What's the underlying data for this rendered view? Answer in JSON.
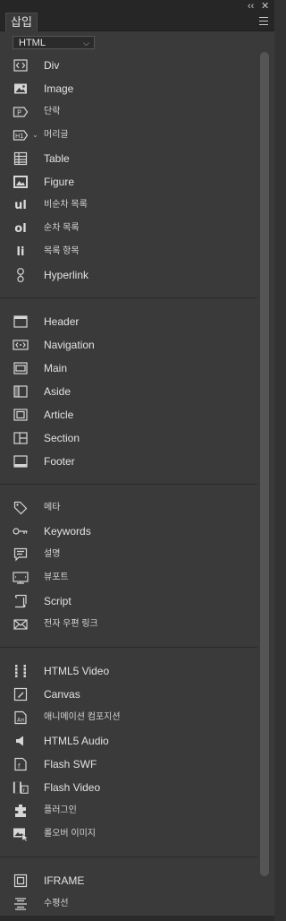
{
  "window": {
    "collapse_glyph": "‹‹",
    "close_glyph": "✕"
  },
  "panel": {
    "tab_title": "삽입",
    "category_select": "HTML"
  },
  "groups": [
    [
      {
        "id": "div",
        "label": "Div",
        "icon": "div-icon"
      },
      {
        "id": "image",
        "label": "Image",
        "icon": "image-icon"
      },
      {
        "id": "paragraph",
        "label": "단락",
        "icon": "paragraph-icon"
      },
      {
        "id": "heading",
        "label": "머리글",
        "icon": "heading-icon",
        "dropdown": true
      },
      {
        "id": "table",
        "label": "Table",
        "icon": "table-icon"
      },
      {
        "id": "figure",
        "label": "Figure",
        "icon": "figure-icon"
      },
      {
        "id": "ul",
        "label": "비순차 목록",
        "icon": "unordered-list-icon",
        "text_icon": "ul"
      },
      {
        "id": "ol",
        "label": "순차 목록",
        "icon": "ordered-list-icon",
        "text_icon": "ol"
      },
      {
        "id": "li",
        "label": "목록 항목",
        "icon": "list-item-icon",
        "text_icon": "li"
      },
      {
        "id": "hyperlink",
        "label": "Hyperlink",
        "icon": "hyperlink-icon"
      }
    ],
    [
      {
        "id": "header",
        "label": "Header",
        "icon": "header-icon"
      },
      {
        "id": "navigation",
        "label": "Navigation",
        "icon": "navigation-icon"
      },
      {
        "id": "main",
        "label": "Main",
        "icon": "main-icon"
      },
      {
        "id": "aside",
        "label": "Aside",
        "icon": "aside-icon"
      },
      {
        "id": "article",
        "label": "Article",
        "icon": "article-icon"
      },
      {
        "id": "section",
        "label": "Section",
        "icon": "section-icon"
      },
      {
        "id": "footer",
        "label": "Footer",
        "icon": "footer-icon"
      }
    ],
    [
      {
        "id": "meta",
        "label": "메타",
        "icon": "tag-icon"
      },
      {
        "id": "keywords",
        "label": "Keywords",
        "icon": "key-icon"
      },
      {
        "id": "description",
        "label": "설명",
        "icon": "description-icon"
      },
      {
        "id": "viewport",
        "label": "뷰포트",
        "icon": "viewport-icon"
      },
      {
        "id": "script",
        "label": "Script",
        "icon": "script-icon"
      },
      {
        "id": "email",
        "label": "전자 우편 링크",
        "icon": "email-icon"
      }
    ],
    [
      {
        "id": "video",
        "label": "HTML5 Video",
        "icon": "video-icon"
      },
      {
        "id": "canvas",
        "label": "Canvas",
        "icon": "canvas-icon"
      },
      {
        "id": "animation",
        "label": "애니메이션 컴포지션",
        "icon": "animation-icon"
      },
      {
        "id": "audio",
        "label": "HTML5 Audio",
        "icon": "audio-icon"
      },
      {
        "id": "flashswf",
        "label": "Flash SWF",
        "icon": "flash-swf-icon"
      },
      {
        "id": "flashvideo",
        "label": "Flash Video",
        "icon": "flash-video-icon"
      },
      {
        "id": "plugin",
        "label": "플러그인",
        "icon": "plugin-icon"
      },
      {
        "id": "rollover",
        "label": "롤오버 이미지",
        "icon": "rollover-image-icon"
      }
    ],
    [
      {
        "id": "iframe",
        "label": "IFRAME",
        "icon": "iframe-icon"
      },
      {
        "id": "hr",
        "label": "수평선",
        "icon": "horizontal-rule-icon"
      }
    ]
  ]
}
